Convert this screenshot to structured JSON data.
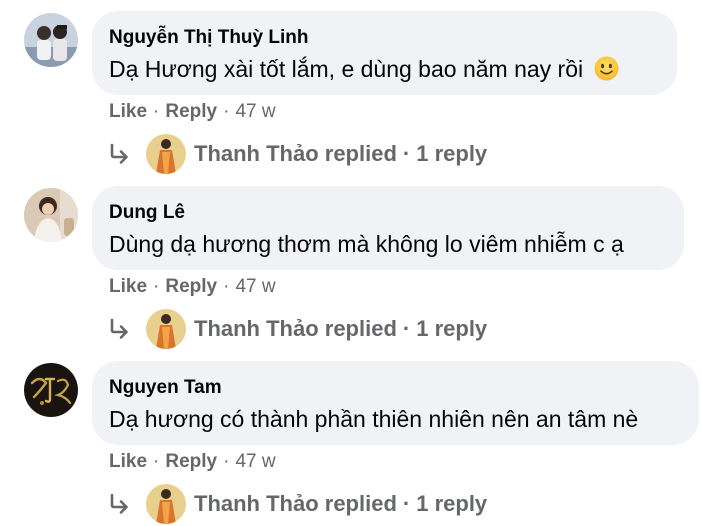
{
  "comments": [
    {
      "author": "Nguyễn Thị Thuỳ Linh",
      "text": "Dạ Hương xài tốt lắm, e dùng bao năm nay rồi",
      "emoji": "slightly-smiling-face-emoji",
      "avatar": "avatar-couple-photo",
      "like_label": "Like",
      "reply_label": "Reply",
      "time": "47 w",
      "replies": {
        "name": "Thanh Thảo replied",
        "count": "1 reply"
      }
    },
    {
      "author": "Dung Lê",
      "text": "Dùng dạ hương thơm mà không lo viêm nhiễm c ạ",
      "avatar": "avatar-woman-photo",
      "like_label": "Like",
      "reply_label": "Reply",
      "time": "47 w",
      "replies": {
        "name": "Thanh Thảo replied",
        "count": "1 reply"
      }
    },
    {
      "author": "Nguyen Tam",
      "text": "Dạ hương có thành phần thiên nhiên nên an tâm nè",
      "avatar": "avatar-gold-calligraphy",
      "like_label": "Like",
      "reply_label": "Reply",
      "time": "47 w",
      "replies": {
        "name": "Thanh Thảo replied",
        "count": "1 reply"
      }
    }
  ],
  "separator": "·",
  "colors": {
    "bubble": "#f0f2f5",
    "secondary_text": "#65676b",
    "primary_text": "#050505"
  }
}
